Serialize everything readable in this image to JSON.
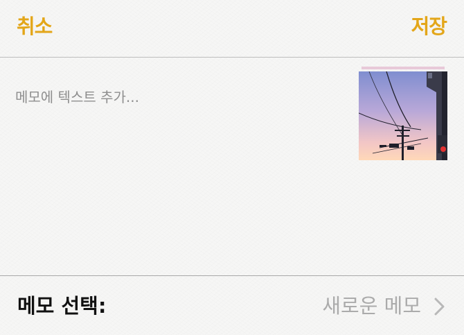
{
  "nav": {
    "cancel_label": "취소",
    "save_label": "저장",
    "accent_color": "#e3a619"
  },
  "memo": {
    "placeholder": "메모에 텍스트 추가...",
    "text": ""
  },
  "attachment": {
    "icon": "image-thumbnail"
  },
  "footer": {
    "label": "메모 선택:",
    "value": "새로운 메모",
    "chevron_icon": "chevron-right-icon"
  }
}
